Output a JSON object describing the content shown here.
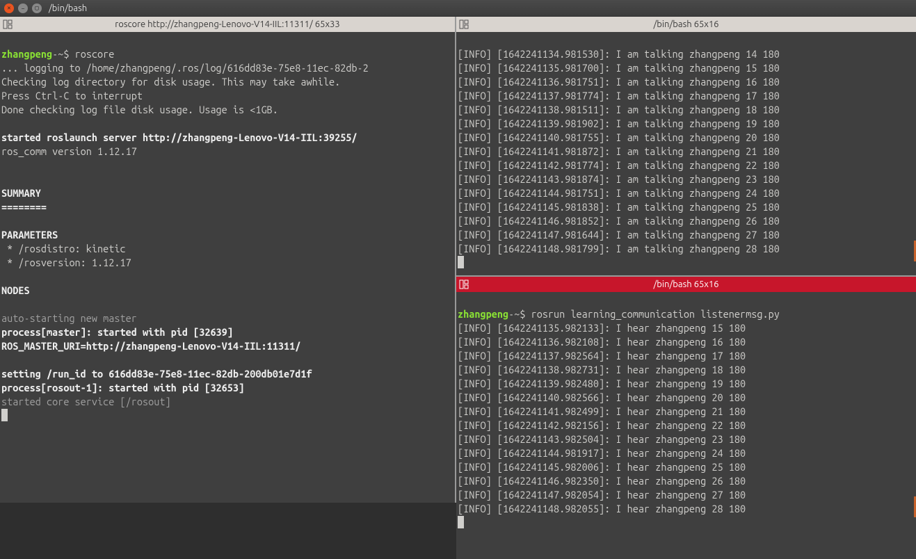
{
  "window": {
    "title": "/bin/bash"
  },
  "panes": {
    "left": {
      "title": "roscore http://zhangpeng-Lenovo-V14-IIL:11311/ 65x33",
      "prompt_user": "zhangpeng",
      "prompt_sep": "-~$ ",
      "command": "roscore",
      "line_logging": "... logging to /home/zhangpeng/.ros/log/616dd83e-75e8-11ec-82db-2",
      "line_checking": "Checking log directory for disk usage. This may take awhile.",
      "line_ctrlc": "Press Ctrl-C to interrupt",
      "line_done": "Done checking log file disk usage. Usage is <1GB.",
      "line_started_server": "started roslaunch server http://zhangpeng-Lenovo-V14-IIL:39255/",
      "line_roscomm": "ros_comm version 1.12.17",
      "line_summary": "SUMMARY",
      "line_summary_sep": "========",
      "line_parameters": "PARAMETERS",
      "line_rosdistro": " * /rosdistro: kinetic",
      "line_rosversion": " * /rosversion: 1.12.17",
      "line_nodes": "NODES",
      "line_autostart": "auto-starting new master",
      "line_process_master": "process[master]: started with pid [32639]",
      "line_master_uri": "ROS_MASTER_URI=http://zhangpeng-Lenovo-V14-IIL:11311/",
      "line_runid": "setting /run_id to 616dd83e-75e8-11ec-82db-200db01e7d1f",
      "line_process_rosout": "process[rosout-1]: started with pid [32653]",
      "line_started_core": "started core service [/rosout]"
    },
    "top_right": {
      "title": "/bin/bash 65x16",
      "lines": [
        "[INFO] [1642241134.981530]: I am talking zhangpeng 14 180",
        "[INFO] [1642241135.981700]: I am talking zhangpeng 15 180",
        "[INFO] [1642241136.981751]: I am talking zhangpeng 16 180",
        "[INFO] [1642241137.981774]: I am talking zhangpeng 17 180",
        "[INFO] [1642241138.981511]: I am talking zhangpeng 18 180",
        "[INFO] [1642241139.981902]: I am talking zhangpeng 19 180",
        "[INFO] [1642241140.981755]: I am talking zhangpeng 20 180",
        "[INFO] [1642241141.981872]: I am talking zhangpeng 21 180",
        "[INFO] [1642241142.981774]: I am talking zhangpeng 22 180",
        "[INFO] [1642241143.981874]: I am talking zhangpeng 23 180",
        "[INFO] [1642241144.981751]: I am talking zhangpeng 24 180",
        "[INFO] [1642241145.981838]: I am talking zhangpeng 25 180",
        "[INFO] [1642241146.981852]: I am talking zhangpeng 26 180",
        "[INFO] [1642241147.981644]: I am talking zhangpeng 27 180",
        "[INFO] [1642241148.981799]: I am talking zhangpeng 28 180"
      ]
    },
    "bottom_right": {
      "title": "/bin/bash 65x16",
      "prompt_user": "zhangpeng",
      "prompt_sep": "-~$ ",
      "command": "rosrun learning_communication listenermsg.py",
      "lines": [
        "[INFO] [1642241135.982133]: I hear zhangpeng 15 180",
        "[INFO] [1642241136.982108]: I hear zhangpeng 16 180",
        "[INFO] [1642241137.982564]: I hear zhangpeng 17 180",
        "[INFO] [1642241138.982731]: I hear zhangpeng 18 180",
        "[INFO] [1642241139.982480]: I hear zhangpeng 19 180",
        "[INFO] [1642241140.982566]: I hear zhangpeng 20 180",
        "[INFO] [1642241141.982499]: I hear zhangpeng 21 180",
        "[INFO] [1642241142.982156]: I hear zhangpeng 22 180",
        "[INFO] [1642241143.982504]: I hear zhangpeng 23 180",
        "[INFO] [1642241144.981917]: I hear zhangpeng 24 180",
        "[INFO] [1642241145.982006]: I hear zhangpeng 25 180",
        "[INFO] [1642241146.982350]: I hear zhangpeng 26 180",
        "[INFO] [1642241147.982054]: I hear zhangpeng 27 180",
        "[INFO] [1642241148.982055]: I hear zhangpeng 28 180"
      ]
    }
  }
}
